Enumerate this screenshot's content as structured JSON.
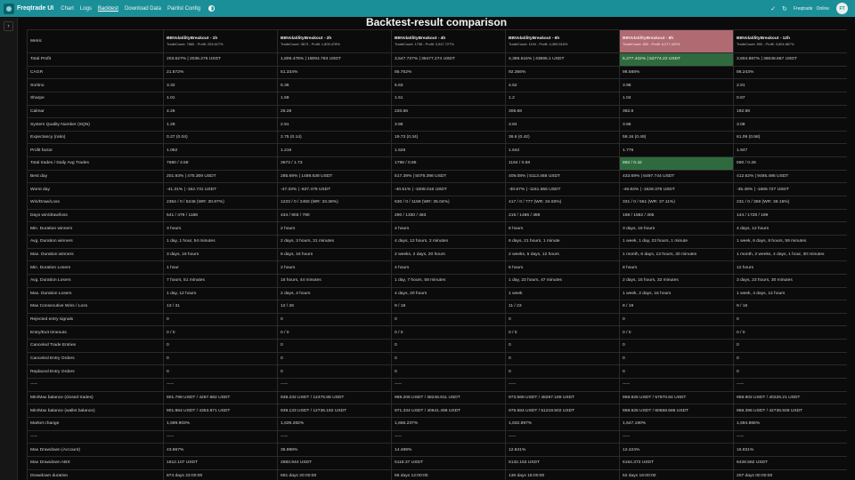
{
  "navbar": {
    "brand": "Freqtrade UI",
    "links": [
      {
        "label": "Chart"
      },
      {
        "label": "Logs"
      },
      {
        "label": "Backtest",
        "active": true
      },
      {
        "label": "Download Data"
      },
      {
        "label": "Pairlist Config"
      }
    ],
    "status_left": "Freqtrade",
    "status_right": "Online",
    "avatar": "FT"
  },
  "page": {
    "title": "Backtest-result comparison"
  },
  "table": {
    "metric_header": "Metric",
    "strategies": [
      {
        "name": "BBVolatilityBreakout - 1h",
        "sub": "TradeCount: 7680 - Profit: 203.627%",
        "best": false
      },
      {
        "name": "BBVolatilityBreakout - 2h",
        "sub": "TradeCount: 3673 - Profit: 1,809.478%",
        "best": false
      },
      {
        "name": "BBVolatilityBreakout - 4h",
        "sub": "TradeCount: 1798 - Profit: 3,547.727%",
        "best": false
      },
      {
        "name": "BBVolatilityBreakout - 6h",
        "sub": "TradeCount: 1194 - Profit: 4,369.516%",
        "best": false
      },
      {
        "name": "BBVolatilityBreakout - 8h",
        "sub": "TradeCount: 892 - Profit: 5,277.422%",
        "best": true
      },
      {
        "name": "BBVolatilityBreakout - 12h",
        "sub": "TradeCount: 590 - Profit: 3,604.867%",
        "best": false
      }
    ],
    "rows": [
      {
        "metric": "Total Profit",
        "values": [
          "203.627% | 2036.275 USDT",
          "1,809.478% | 18094.783 USDT",
          "3,547.727% | 35477.274 USDT",
          "4,369.516% | 43695.1 USDT",
          "5,277.422% | 52774.22 USDT",
          "3,604.867% | 36048.667 USDT"
        ],
        "highlight": 4
      },
      {
        "metric": "CAGR",
        "values": [
          "21.872%",
          "51.334%",
          "85.752%",
          "92.366%",
          "98.588%",
          "86.243%"
        ]
      },
      {
        "metric": "Sortino",
        "values": [
          "3.32",
          "5.36",
          "5.63",
          "4.52",
          "3.98",
          "2.91"
        ]
      },
      {
        "metric": "Sharpe",
        "values": [
          "1.01",
          "1.59",
          "1.51",
          "1.2",
          "1.04",
          "0.67"
        ]
      },
      {
        "metric": "Calmar",
        "values": [
          "4.26",
          "25.28",
          "220.66",
          "306.66",
          "382.8",
          "192.98"
        ]
      },
      {
        "metric": "System Quality Number (SQN)",
        "values": [
          "1.29",
          "2.91",
          "3.96",
          "3.84",
          "3.86",
          "3.08"
        ]
      },
      {
        "metric": "Expectancy (ratio)",
        "values": [
          "0.27 (0.04)",
          "2.75 (0.14)",
          "19.73 (0.34)",
          "36.6 (0.42)",
          "59.16 (0.49)",
          "61.09 (0.58)"
        ]
      },
      {
        "metric": "Profit factor",
        "values": [
          "1.062",
          "1.216",
          "1.526",
          "1.642",
          "1.776",
          "1.947"
        ]
      },
      {
        "metric": "Total trades / Daily Avg Trades",
        "values": [
          "7680 / 3.58",
          "3673 / 1.73",
          "1798 / 0.85",
          "1194 / 0.58",
          "892 / 0.42",
          "590 / 0.28"
        ],
        "highlight": 4
      },
      {
        "metric": "Best day",
        "values": [
          "201.93% | 475.309 USDT",
          "285.69% | 1489.638 USDT",
          "517.39% | 5079.398 USDT",
          "409.08% | 5113.468 USDT",
          "433.69% | 6497.744 USDT",
          "412.62% | 9485.495 USDT"
        ]
      },
      {
        "metric": "Worst day",
        "values": [
          "-41.31% | -152.731 USDT",
          "-47.33% | -637.479 USDT",
          "-40.51% | -1008.016 USDT",
          "-30.67% | -1161.555 USDT",
          "-46.84% | -1629.378 USDT",
          "-35.48% | -1666.727 USDT"
        ]
      },
      {
        "metric": "Win/Draw/Loss",
        "values": [
          "2354 / 0 / 5246 (WR: 30.97%)",
          "1223 / 0 / 2450 (WR: 33.38%)",
          "630 / 0 / 1168 (WR: 35.04%)",
          "417 / 0 / 777 (WR: 34.92%)",
          "331 / 0 / 561 (WR: 37.11%)",
          "231 / 0 / 359 (WR: 39.15%)"
        ]
      },
      {
        "metric": "Days win/draw/loss",
        "values": [
          "541 / 479 / 1188",
          "434 / 903 / 780",
          "290 / 1330 / 483",
          "219 / 1486 / 388",
          "198 / 1582 / 305",
          "144 / 1728 / 199"
        ]
      },
      {
        "metric": "Min. Duration winners",
        "values": [
          "3 hours",
          "2 hours",
          "4 hours",
          "6 hours",
          "3 days, 16 hours",
          "4 days, 12 hours"
        ]
      },
      {
        "metric": "Avg. Duration winners",
        "values": [
          "1 day, 1 hour, 54 minutes",
          "2 days, 3 hours, 31 minutes",
          "4 days, 12 hours, 2 minutes",
          "6 days, 21 hours, 1 minute",
          "1 week, 1 day, 23 hours, 1 minute",
          "1 week, 6 days, 8 hours, 59 minutes"
        ]
      },
      {
        "metric": "Max. Duration winners",
        "values": [
          "3 days, 16 hours",
          "6 days, 16 hours",
          "2 weeks, 2 days, 20 hours",
          "2 weeks, 5 days, 12 hours",
          "1 month, 6 days, 13 hours, 30 minutes",
          "1 month, 2 weeks, 4 days, 1 hour, 30 minutes"
        ]
      },
      {
        "metric": "Min. Duration Losers",
        "values": [
          "1 hour",
          "2 hours",
          "4 hours",
          "6 hours",
          "8 hours",
          "12 hours"
        ]
      },
      {
        "metric": "Avg. Duration Losers",
        "values": [
          "7 hours, 51 minutes",
          "15 hours, 44 minutes",
          "1 day, 7 hours, 58 minutes",
          "1 day, 23 hours, 47 minutes",
          "2 days, 15 hours, 32 minutes",
          "3 days, 23 hours, 30 minutes"
        ]
      },
      {
        "metric": "Max. Duration Losers",
        "values": [
          "1 day, 12 hours",
          "2 days, 4 hours",
          "4 days, 20 hours",
          "1 week",
          "1 week, 2 days, 16 hours",
          "1 week, 4 days, 12 hours"
        ]
      },
      {
        "metric": "Max Consecutive Wins / Loss",
        "values": [
          "13 / 31",
          "12 / 26",
          "9 / 18",
          "11 / 23",
          "8 / 19",
          "9 / 16"
        ]
      },
      {
        "metric": "Rejected entry signals",
        "values": [
          "0",
          "0",
          "0",
          "0",
          "0",
          "0"
        ]
      },
      {
        "metric": "Entry/Exit timeouts",
        "values": [
          "0 / 0",
          "0 / 0",
          "0 / 0",
          "0 / 0",
          "0 / 0",
          "0 / 0"
        ]
      },
      {
        "metric": "Canceled Trade Entries",
        "values": [
          "0",
          "0",
          "0",
          "0",
          "0",
          "0"
        ]
      },
      {
        "metric": "Canceled Entry Orders",
        "values": [
          "0",
          "0",
          "0",
          "0",
          "0",
          "0"
        ]
      },
      {
        "metric": "Replaced Entry Orders",
        "values": [
          "0",
          "0",
          "0",
          "0",
          "0",
          "0"
        ]
      },
      {
        "metric": "-----",
        "values": [
          "-----",
          "-----",
          "-----",
          "-----",
          "-----",
          "-----"
        ]
      },
      {
        "metric": "Min/Max balance (closed trades)",
        "values": [
          "901.798 USDT / 4267.682 USDT",
          "938.232 USDT / 12475.86 USDT",
          "969.206 USDT / 38246.811 USDT",
          "973.568 USDT / 48297.189 USDT",
          "959.925 USDT / 57970.84 USDT",
          "959.902 USDT / 40226.21 USDT"
        ]
      },
      {
        "metric": "Min/Max balance (wallet balance)",
        "values": [
          "901.964 USDT / 4353.871 USDT",
          "939.133 USDT / 12736.182 USDT",
          "971.334 USDT / 40641.498 USDT",
          "975.584 USDT / 51219.502 USDT",
          "959.925 USDT / 60658.586 USDT",
          "959.396 USDT / 42736.928 USDT"
        ]
      },
      {
        "metric": "Market change",
        "values": [
          "1,599.903%",
          "1,639.282%",
          "1,656.237%",
          "1,632.897%",
          "1,647.190%",
          "1,594.865%"
        ]
      },
      {
        "metric": "-----",
        "values": [
          "-----",
          "-----",
          "-----",
          "-----",
          "-----",
          "-----"
        ]
      },
      {
        "metric": "Max Drawdown (Account)",
        "values": [
          "43.867%",
          "35.998%",
          "14.489%",
          "12.841%",
          "12.424%",
          "16.831%"
        ]
      },
      {
        "metric": "Max Drawdown ABS",
        "values": [
          "1812.107 USDT",
          "2883.944 USDT",
          "5118.37 USDT",
          "5132.153 USDT",
          "6154.373 USDT",
          "6428.582 USDT"
        ]
      },
      {
        "metric": "Drawdown duration",
        "values": [
          "874 days 23:00:00",
          "691 days 20:00:00",
          "56 days 12:00:00",
          "130 days 18:00:00",
          "52 days 16:00:00",
          "207 days 00:00:00"
        ]
      }
    ]
  }
}
